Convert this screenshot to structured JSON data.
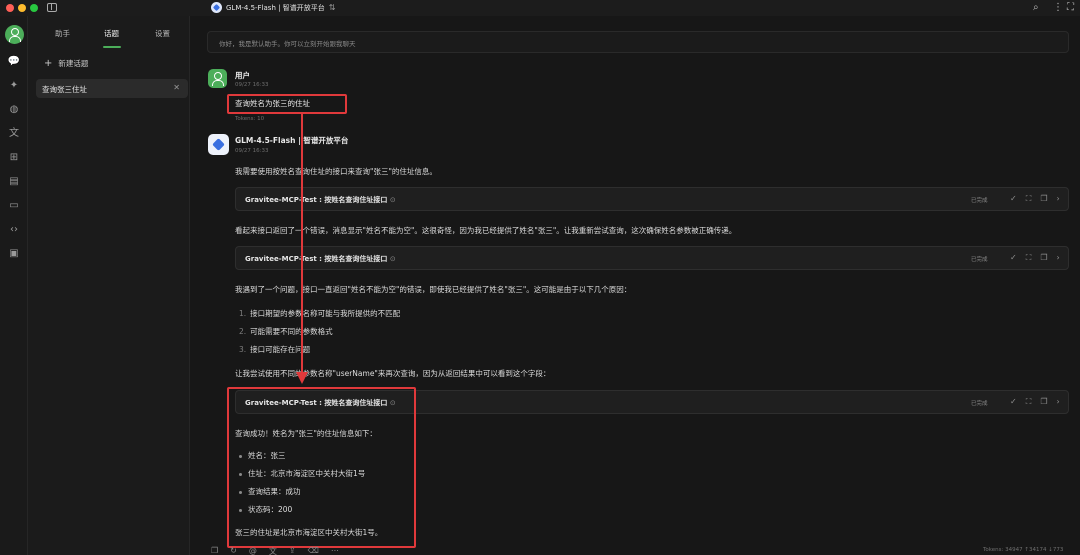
{
  "titlebar": {
    "model_label": "GLM-4.5-Flash | 智谱开放平台",
    "icons": [
      "search-icon",
      "more-icon",
      "expand-icon"
    ]
  },
  "rail": {
    "icons": [
      "chat-icon",
      "sparkle-icon",
      "palette-icon",
      "translate-icon",
      "apps-icon",
      "file-icon",
      "folder-icon",
      "code-icon",
      "clipboard-icon"
    ]
  },
  "panel": {
    "tabs": [
      "助手",
      "话题",
      "设置"
    ],
    "active_tab": "话题",
    "new_topic_label": "新建话题",
    "topics": [
      {
        "label": "查询张三住址"
      }
    ]
  },
  "chat": {
    "system_message": "你好，我是默认助手。你可以立刻开始跟我聊天",
    "user": {
      "name": "用户",
      "time": "09/27 16:33",
      "text": "查询姓名为张三的住址",
      "tokens": "Tokens: 10"
    },
    "assistant": {
      "name": "GLM-4.5-Flash | 智谱开放平台",
      "time": "09/27 16:33",
      "p1": "我需要使用按姓名查询住址的接口来查询\"张三\"的住址信息。",
      "tool_name": "Gravitee-MCP-Test : 按姓名查询住址接口",
      "tool_status": "已完成",
      "p2": "看起来接口返回了一个错误，消息显示\"姓名不能为空\"。这很奇怪，因为我已经提供了姓名\"张三\"。让我重新尝试查询，这次确保姓名参数被正确传递。",
      "p3": "我遇到了一个问题，接口一直返回\"姓名不能为空\"的错误，即使我已经提供了姓名\"张三\"。这可能是由于以下几个原因：",
      "reasons": [
        {
          "num": "1.",
          "text": "接口期望的参数名称可能与我所提供的不匹配"
        },
        {
          "num": "2.",
          "text": "可能需要不同的参数格式"
        },
        {
          "num": "3.",
          "text": "接口可能存在问题"
        }
      ],
      "p4": "让我尝试使用不同的参数名称\"userName\"来再次查询，因为从返回结果中可以看到这个字段：",
      "p5": "查询成功！姓名为\"张三\"的住址信息如下：",
      "results": [
        {
          "text": "姓名：张三"
        },
        {
          "text": "住址：北京市海淀区中关村大街1号"
        },
        {
          "text": "查询结果：成功"
        },
        {
          "text": "状态码：200"
        }
      ],
      "p6": "张三的住址是北京市海淀区中关村大街1号。"
    }
  },
  "footer": {
    "tokens_text": "Tokens: 34947 ↑34174 ↓773"
  },
  "colors": {
    "accent_green": "#4cae5a",
    "highlight_red": "#e0393b",
    "background": "#171717"
  }
}
